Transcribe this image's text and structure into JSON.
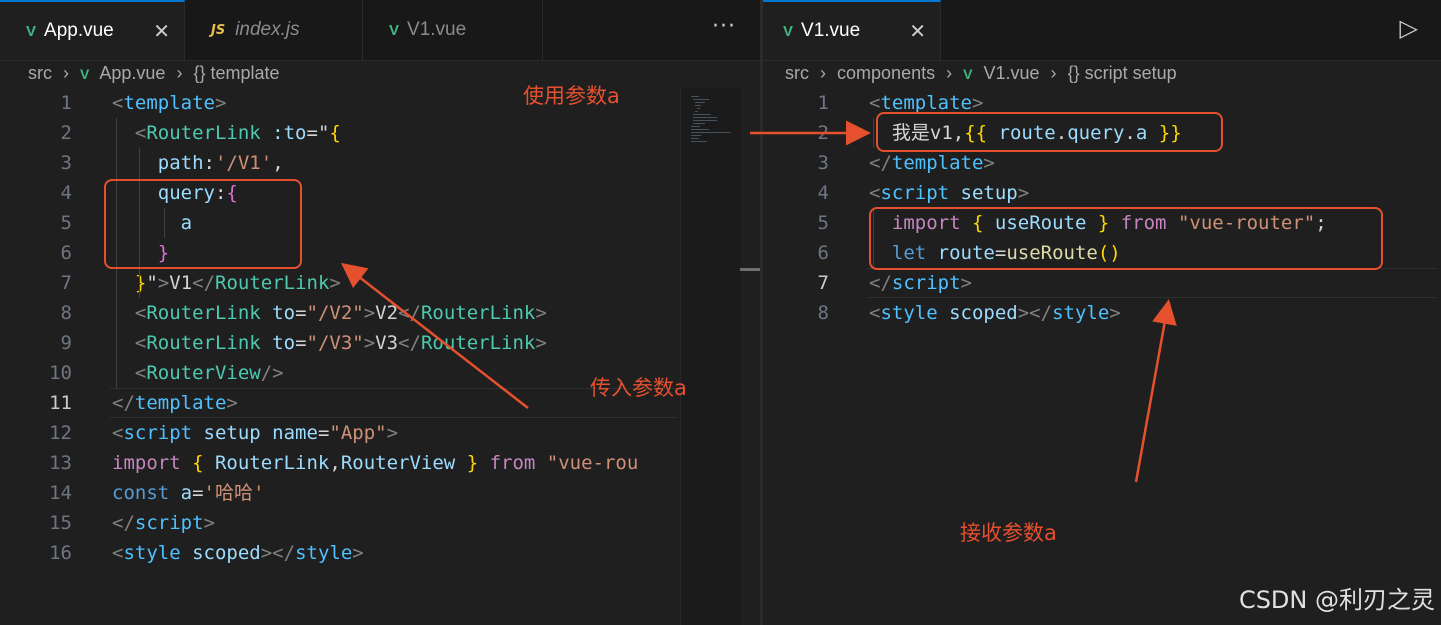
{
  "left": {
    "tabs": [
      {
        "label": "App.vue",
        "icon": "vue-icon",
        "active": true
      },
      {
        "label": "index.js",
        "icon": "js-icon",
        "icon_text": "JS",
        "active": false
      },
      {
        "label": "V1.vue",
        "icon": "vue-icon",
        "active": false
      }
    ],
    "more_glyph": "···",
    "breadcrumb": [
      "src",
      "App.vue",
      "{} template"
    ],
    "line_numbers": [
      "1",
      "2",
      "3",
      "4",
      "5",
      "6",
      "7",
      "8",
      "9",
      "10",
      "11",
      "12",
      "13",
      "14",
      "15",
      "16"
    ],
    "code_lines": [
      [
        [
          "<",
          "c-tagp"
        ],
        [
          "template",
          "c-tag"
        ],
        [
          ">",
          "c-tagp"
        ]
      ],
      [
        [
          "  ",
          "c-plain"
        ],
        [
          "<",
          "c-tagp"
        ],
        [
          "RouterLink",
          "c-comp"
        ],
        [
          " :to",
          "c-attr"
        ],
        [
          "=",
          "c-plain"
        ],
        [
          "\"",
          "c-plain"
        ],
        [
          "{",
          "c-br1"
        ]
      ],
      [
        [
          "    ",
          "c-plain"
        ],
        [
          "path",
          "c-var"
        ],
        [
          ":",
          "c-plain"
        ],
        [
          "'/V1'",
          "c-str"
        ],
        [
          ",",
          "c-plain"
        ]
      ],
      [
        [
          "    ",
          "c-plain"
        ],
        [
          "query",
          "c-var"
        ],
        [
          ":",
          "c-plain"
        ],
        [
          "{",
          "c-br2"
        ]
      ],
      [
        [
          "      ",
          "c-plain"
        ],
        [
          "a",
          "c-var"
        ]
      ],
      [
        [
          "    ",
          "c-plain"
        ],
        [
          "}",
          "c-br2"
        ]
      ],
      [
        [
          "  ",
          "c-plain"
        ],
        [
          "}",
          "c-br1"
        ],
        [
          "\"",
          "c-plain"
        ],
        [
          ">",
          "c-tagp"
        ],
        [
          "V1",
          "c-plain"
        ],
        [
          "</",
          "c-tagp"
        ],
        [
          "RouterLink",
          "c-comp"
        ],
        [
          ">",
          "c-tagp"
        ]
      ],
      [
        [
          "  ",
          "c-plain"
        ],
        [
          "<",
          "c-tagp"
        ],
        [
          "RouterLink",
          "c-comp"
        ],
        [
          " to",
          "c-attr"
        ],
        [
          "=",
          "c-plain"
        ],
        [
          "\"/V2\"",
          "c-str"
        ],
        [
          ">",
          "c-tagp"
        ],
        [
          "V2",
          "c-plain"
        ],
        [
          "</",
          "c-tagp"
        ],
        [
          "RouterLink",
          "c-comp"
        ],
        [
          ">",
          "c-tagp"
        ]
      ],
      [
        [
          "  ",
          "c-plain"
        ],
        [
          "<",
          "c-tagp"
        ],
        [
          "RouterLink",
          "c-comp"
        ],
        [
          " to",
          "c-attr"
        ],
        [
          "=",
          "c-plain"
        ],
        [
          "\"/V3\"",
          "c-str"
        ],
        [
          ">",
          "c-tagp"
        ],
        [
          "V3",
          "c-plain"
        ],
        [
          "</",
          "c-tagp"
        ],
        [
          "RouterLink",
          "c-comp"
        ],
        [
          ">",
          "c-tagp"
        ]
      ],
      [
        [
          "  ",
          "c-plain"
        ],
        [
          "<",
          "c-tagp"
        ],
        [
          "RouterView",
          "c-comp"
        ],
        [
          "/>",
          "c-tagp"
        ]
      ],
      [
        [
          "</",
          "c-tagp"
        ],
        [
          "template",
          "c-tag"
        ],
        [
          ">",
          "c-tagp"
        ]
      ],
      [
        [
          "<",
          "c-tagp"
        ],
        [
          "script",
          "c-tag"
        ],
        [
          " setup",
          "c-attr"
        ],
        [
          " name",
          "c-attr"
        ],
        [
          "=",
          "c-plain"
        ],
        [
          "\"App\"",
          "c-str"
        ],
        [
          ">",
          "c-tagp"
        ]
      ],
      [
        [
          "import",
          "c-kw"
        ],
        [
          " ",
          "c-plain"
        ],
        [
          "{",
          "c-br1"
        ],
        [
          " RouterLink",
          "c-var"
        ],
        [
          ",",
          "c-plain"
        ],
        [
          "RouterView",
          "c-var"
        ],
        [
          " ",
          "c-plain"
        ],
        [
          "}",
          "c-br1"
        ],
        [
          " from",
          "c-kw"
        ],
        [
          " \"vue-rou",
          "c-str"
        ]
      ],
      [
        [
          "const",
          "c-blue"
        ],
        [
          " a",
          "c-var"
        ],
        [
          "=",
          "c-plain"
        ],
        [
          "'哈哈'",
          "c-str"
        ]
      ],
      [
        [
          "</",
          "c-tagp"
        ],
        [
          "script",
          "c-tag"
        ],
        [
          ">",
          "c-tagp"
        ]
      ],
      [
        [
          "<",
          "c-tagp"
        ],
        [
          "style",
          "c-tag"
        ],
        [
          " scoped",
          "c-attr"
        ],
        [
          "></",
          "c-tagp"
        ],
        [
          "style",
          "c-tag"
        ],
        [
          ">",
          "c-tagp"
        ]
      ]
    ],
    "current_line": 11
  },
  "right": {
    "tabs": [
      {
        "label": "V1.vue",
        "icon": "vue-icon",
        "active": true
      }
    ],
    "close_glyph": "✕",
    "run_glyph": "▷",
    "breadcrumb": [
      "src",
      "components",
      "V1.vue",
      "{} script setup"
    ],
    "line_numbers": [
      "1",
      "2",
      "3",
      "4",
      "5",
      "6",
      "7",
      "8"
    ],
    "code_lines": [
      [
        [
          "<",
          "c-tagp"
        ],
        [
          "template",
          "c-tag"
        ],
        [
          ">",
          "c-tagp"
        ]
      ],
      [
        [
          "  ",
          "c-plain"
        ],
        [
          "我是v1,",
          "c-plain"
        ],
        [
          "{{",
          "c-br1"
        ],
        [
          " route",
          "c-var"
        ],
        [
          ".",
          "c-plain"
        ],
        [
          "query",
          "c-var"
        ],
        [
          ".",
          "c-plain"
        ],
        [
          "a",
          "c-var"
        ],
        [
          " ",
          "c-plain"
        ],
        [
          "}}",
          "c-br1"
        ]
      ],
      [
        [
          "</",
          "c-tagp"
        ],
        [
          "template",
          "c-tag"
        ],
        [
          ">",
          "c-tagp"
        ]
      ],
      [
        [
          "<",
          "c-tagp"
        ],
        [
          "script",
          "c-tag"
        ],
        [
          " setup",
          "c-attr"
        ],
        [
          ">",
          "c-tagp"
        ]
      ],
      [
        [
          "  ",
          "c-plain"
        ],
        [
          "import",
          "c-kw"
        ],
        [
          " ",
          "c-plain"
        ],
        [
          "{",
          "c-br1"
        ],
        [
          " useRoute",
          "c-var"
        ],
        [
          " ",
          "c-plain"
        ],
        [
          "}",
          "c-br1"
        ],
        [
          " from",
          "c-kw"
        ],
        [
          " \"vue-router\"",
          "c-str"
        ],
        [
          ";",
          "c-plain"
        ]
      ],
      [
        [
          "  ",
          "c-plain"
        ],
        [
          "let",
          "c-blue"
        ],
        [
          " route",
          "c-var"
        ],
        [
          "=",
          "c-plain"
        ],
        [
          "useRoute",
          "c-fn"
        ],
        [
          "()",
          "c-br1"
        ]
      ],
      [
        [
          "</",
          "c-tagp"
        ],
        [
          "script",
          "c-tag"
        ],
        [
          ">",
          "c-tagp"
        ]
      ],
      [
        [
          "<",
          "c-tagp"
        ],
        [
          "style",
          "c-tag"
        ],
        [
          " scoped",
          "c-attr"
        ],
        [
          "></",
          "c-tagp"
        ],
        [
          "style",
          "c-tag"
        ],
        [
          ">",
          "c-tagp"
        ]
      ]
    ],
    "current_line": 7
  },
  "annotations": {
    "use_param": "使用参数a",
    "pass_param": "传入参数a",
    "receive_param": "接收参数a",
    "color": "#e5502e"
  },
  "watermark": "CSDN @利刃之灵"
}
